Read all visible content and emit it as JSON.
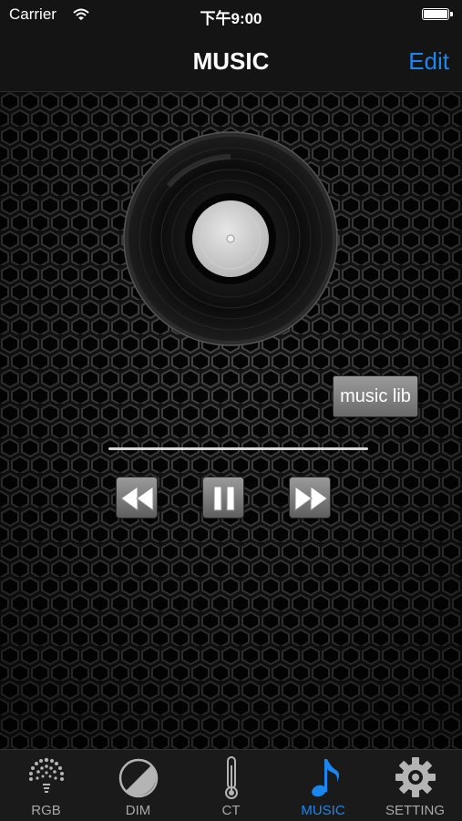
{
  "status_bar": {
    "carrier": "Carrier",
    "time": "下午9:00"
  },
  "nav": {
    "title": "MUSIC",
    "edit_label": "Edit"
  },
  "main": {
    "music_lib_label": "music lib"
  },
  "tabs": [
    {
      "label": "RGB",
      "icon": "rgb-dots-icon",
      "active": false
    },
    {
      "label": "DIM",
      "icon": "dim-circle-icon",
      "active": false
    },
    {
      "label": "CT",
      "icon": "thermometer-icon",
      "active": false
    },
    {
      "label": "MUSIC",
      "icon": "music-note-icon",
      "active": true
    },
    {
      "label": "SETTING",
      "icon": "gear-icon",
      "active": false
    }
  ],
  "colors": {
    "accent": "#1a86f0",
    "bar": "#141414",
    "background": "#151515"
  }
}
